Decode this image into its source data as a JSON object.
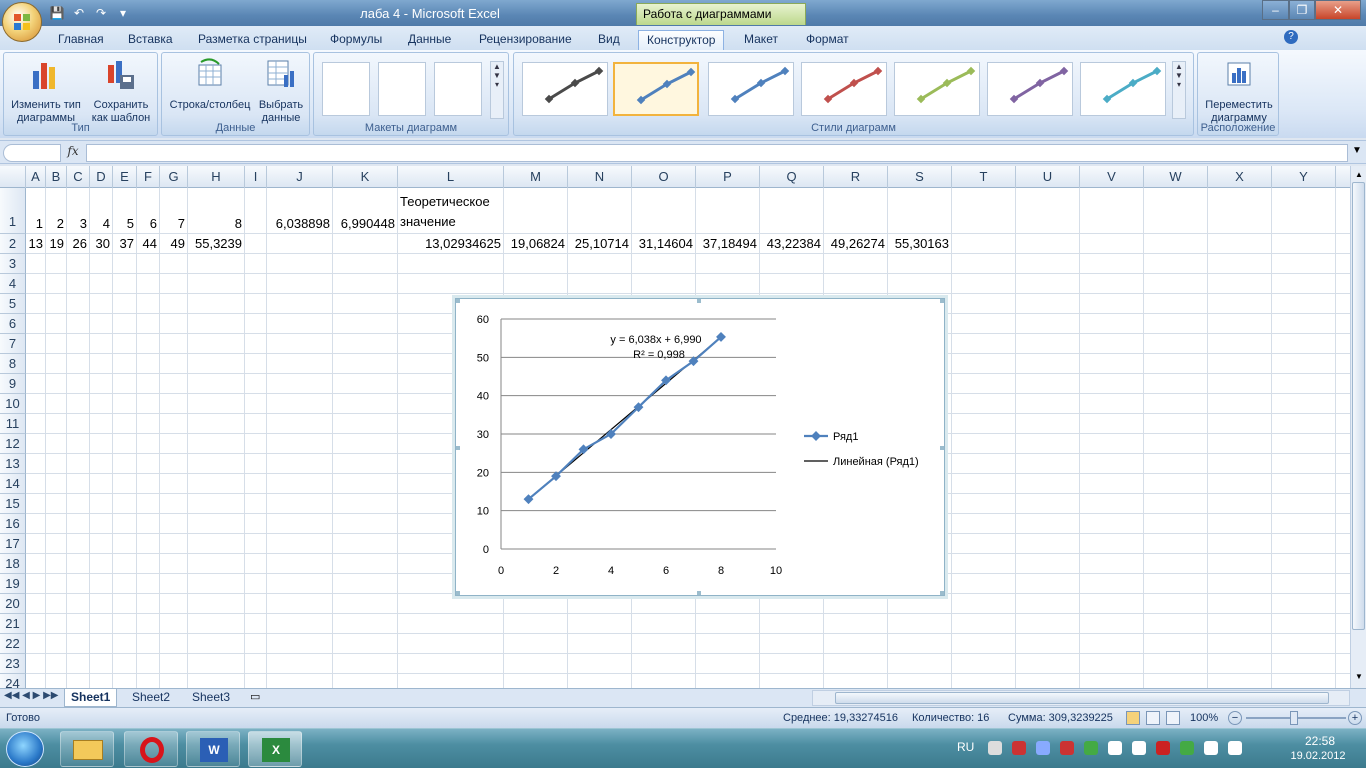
{
  "window": {
    "app_title": "лаба 4 - Microsoft Excel",
    "contextual_tools": "Работа с диаграммами",
    "controls": [
      "–",
      "❐",
      "✕"
    ]
  },
  "ribbon_tabs": [
    "Главная",
    "Вставка",
    "Разметка страницы",
    "Формулы",
    "Данные",
    "Рецензирование",
    "Вид",
    "Конструктор",
    "Макет",
    "Формат"
  ],
  "active_tab": "Конструктор",
  "ribbon": {
    "type_group": {
      "label": "Тип",
      "change_type": "Изменить тип диаграммы",
      "save_template": "Сохранить как шаблон"
    },
    "data_group": {
      "label": "Данные",
      "switch_row_col": "Строка/столбец",
      "select_data": "Выбрать данные"
    },
    "layouts_group": {
      "label": "Макеты диаграмм"
    },
    "styles_group": {
      "label": "Стили диаграмм",
      "colors": [
        "#4a4a4a",
        "#4f81bd",
        "#4f81bd",
        "#c0504d",
        "#9bbb59",
        "#8064a2",
        "#4bacc6"
      ],
      "selected_index": 1
    },
    "location_group": {
      "label": "Расположение",
      "move_chart": "Переместить диаграмму"
    }
  },
  "formula_bar": {
    "fx": "fx",
    "name_box": "",
    "value": ""
  },
  "columns": [
    "A",
    "B",
    "C",
    "D",
    "E",
    "F",
    "G",
    "H",
    "I",
    "J",
    "K",
    "L",
    "M",
    "N",
    "O",
    "P",
    "Q",
    "R",
    "S",
    "T",
    "U",
    "V",
    "W",
    "X",
    "Y"
  ],
  "rows": [
    "1",
    "2",
    "3",
    "4",
    "5",
    "6",
    "7",
    "8",
    "9",
    "10",
    "11",
    "12",
    "13",
    "14",
    "15",
    "16",
    "17",
    "18",
    "19",
    "20",
    "21",
    "22",
    "23",
    "24"
  ],
  "cells": {
    "row1": {
      "A": "1",
      "B": "2",
      "C": "3",
      "D": "4",
      "E": "5",
      "F": "6",
      "G": "7",
      "H": "8",
      "J": "6,038898",
      "K": "6,990448",
      "L1": "Теоретическое",
      "L2": "значение"
    },
    "row2": {
      "A": "13",
      "B": "19",
      "C": "26",
      "D": "30",
      "E": "37",
      "F": "44",
      "G": "49",
      "H": "55,3239",
      "L": "13,02934625",
      "M": "19,06824",
      "N": "25,10714",
      "O": "31,14604",
      "P": "37,18494",
      "Q": "43,22384",
      "R": "49,26274",
      "S": "55,30163"
    }
  },
  "chart_data": {
    "type": "scatter",
    "title": "",
    "xlabel": "",
    "ylabel": "",
    "xlim": [
      0,
      10
    ],
    "ylim": [
      0,
      60
    ],
    "x_ticks": [
      "0",
      "2",
      "4",
      "6",
      "8",
      "10"
    ],
    "y_ticks": [
      "0",
      "10",
      "20",
      "30",
      "40",
      "50",
      "60"
    ],
    "grid": "horizontal",
    "legend_position": "right",
    "series": [
      {
        "name": "Ряд1",
        "x": [
          1,
          2,
          3,
          4,
          5,
          6,
          7,
          8
        ],
        "y": [
          13,
          19,
          26,
          30,
          37,
          44,
          49,
          55.3239
        ],
        "color": "#4f81bd",
        "marker": "diamond"
      },
      {
        "name": "Линейная (Ряд1)",
        "type": "trendline",
        "slope": 6.038,
        "intercept": 6.99,
        "color": "#000000"
      }
    ],
    "equation": "y = 6,038x + 6,990",
    "r_squared": "R² = 0,998"
  },
  "sheet_tabs": [
    "Sheet1",
    "Sheet2",
    "Sheet3"
  ],
  "active_sheet": "Sheet1",
  "status": {
    "ready": "Готово",
    "average": "Среднее: 19,33274516",
    "count": "Количество: 16",
    "sum": "Сумма: 309,3239225",
    "zoom": "100%"
  },
  "taskbar": {
    "lang": "RU",
    "time": "22:58",
    "date": "19.02.2012"
  }
}
